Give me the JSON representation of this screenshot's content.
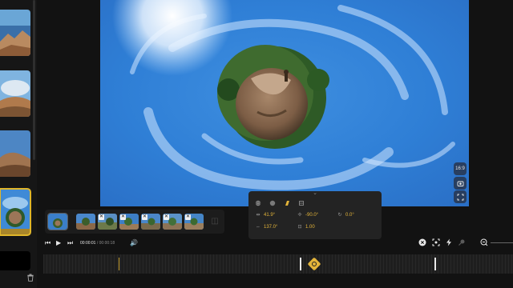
{
  "params": {
    "fov": "41.9°",
    "pitch": "-90.0°",
    "roll": "0.0°",
    "yaw": "137.0°",
    "zoom": "1.00"
  },
  "playback": {
    "current_time": "00:00:01",
    "separator": " / ",
    "total_time": "00:00:18"
  },
  "side_controls": {
    "aspect_label": "16:9"
  },
  "clips": [
    {
      "has_close": false
    },
    {
      "has_close": false
    },
    {
      "has_close": true
    },
    {
      "has_close": true
    },
    {
      "has_close": true
    },
    {
      "has_close": true
    },
    {
      "has_close": true
    }
  ],
  "icons": {
    "prev": "skip-back-icon",
    "play": "play-icon",
    "next": "skip-forward-icon",
    "volume": "volume-icon",
    "delete": "trash-icon",
    "tabs": [
      "sphere-icon",
      "circle-icon",
      "keyframe-icon",
      "layers-icon"
    ]
  },
  "colors": {
    "accent": "#e3b43a",
    "panel": "#232323",
    "background": "#121212"
  }
}
